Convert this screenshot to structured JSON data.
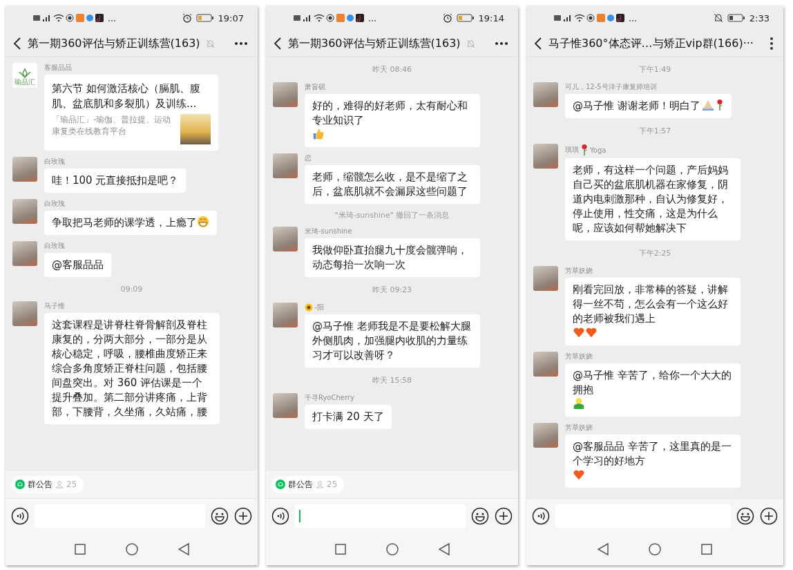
{
  "phones": [
    {
      "status": {
        "time": "19:07",
        "indicator": {
          "kind": "alarm"
        }
      },
      "header": {
        "title": "第一期360评估与矫正训练营(163)",
        "muted": true,
        "menu": {
          "kind": "horizontal"
        }
      },
      "messages": [
        {
          "kind": "link",
          "sender": "客服品品",
          "avatar": {
            "kind": "logo",
            "text": "瑜品汇"
          },
          "title": "第六节  如何激活核心（膈肌、腹肌、盆底肌和多裂肌）及训练...",
          "description": "「瑜品汇」-瑜伽、普拉提、运动康复类在线教育平台"
        },
        {
          "kind": "text",
          "sender": "白玫瑰",
          "avatar": {
            "kind": "photo"
          },
          "text": "哇！100 元直接抵扣是吧？"
        },
        {
          "kind": "text",
          "sender": "白玫瑰",
          "avatar": {
            "kind": "photo"
          },
          "text": "争取把马老师的课学透，上瘾了",
          "emojis": [
            {
              "kind": "grin"
            }
          ]
        },
        {
          "kind": "text",
          "sender": "白玫瑰",
          "avatar": {
            "kind": "photo"
          },
          "text": "@客服品品"
        },
        {
          "kind": "time",
          "text": "09:09"
        },
        {
          "kind": "text",
          "sender": "马子惟",
          "avatar": {
            "kind": "photo"
          },
          "text": "这套课程是讲脊柱脊骨解剖及脊柱康复的，分两大部分，一部分是从核心稳定，呼吸，腰椎曲度矫正来综合多角度矫正脊柱问题，包括腰间盘突出。对 360 评估课是一个提升叠加。第二部分讲疼痛，上背部，下腰背，久坐痛，久站痛，腰"
        }
      ],
      "announcement": {
        "label": "群公告",
        "count": "25"
      },
      "nav_buttons": [
        {
          "kind": "recent"
        },
        {
          "kind": "home"
        },
        {
          "kind": "back"
        }
      ]
    },
    {
      "status": {
        "time": "19:14",
        "indicator": {
          "kind": "alarm"
        }
      },
      "header": {
        "title": "第一期360评估与矫正训练营(163)",
        "muted": true,
        "menu": {
          "kind": "horizontal"
        }
      },
      "messages": [
        {
          "kind": "time",
          "text": "昨天 08:46"
        },
        {
          "kind": "text",
          "sender": "萧旨砚",
          "avatar": {
            "kind": "photo"
          },
          "text": "好的，难得的好老师，太有耐心和专业知识了",
          "emojis": [
            {
              "kind": "thumbs"
            }
          ]
        },
        {
          "kind": "text",
          "sender": "恋",
          "avatar": {
            "kind": "photo"
          },
          "text": "老师，缩髋怎么收，是不是缩了之后，盆底肌就不会漏尿这些问题了"
        },
        {
          "kind": "recall",
          "text": "\"米琦-sunshine\" 撤回了一条消息"
        },
        {
          "kind": "text",
          "sender": "米琦-sunshine",
          "avatar": {
            "kind": "photo"
          },
          "text": "我做仰卧直抬腿九十度会髋弹响，动态每抬一次响一次"
        },
        {
          "kind": "time",
          "text": "昨天 09:23"
        },
        {
          "kind": "text",
          "sender": [
            {
              "kind": "sunflower"
            },
            {
              "kind": "text",
              "text": "-阳"
            }
          ],
          "avatar": {
            "kind": "photo"
          },
          "text": "@马子惟  老师我是不是要松解大腿外侧肌肉，加强腿内收肌的力量练习才可以改善呀？"
        },
        {
          "kind": "time",
          "text": "昨天 15:58"
        },
        {
          "kind": "text",
          "sender": "千寻RyoCherry",
          "avatar": {
            "kind": "photo"
          },
          "text": "打卡满 20 天了"
        }
      ],
      "announcement": {
        "label": "群公告",
        "count": "25"
      },
      "input": {
        "focused": true
      },
      "nav_buttons": [
        {
          "kind": "recent"
        },
        {
          "kind": "home"
        },
        {
          "kind": "back"
        }
      ]
    },
    {
      "status": {
        "time": "2:33",
        "indicator": {
          "kind": "bell-off"
        }
      },
      "header": {
        "title": "马子惟360°体态评…与矫正vip群(166)···",
        "menu": {
          "kind": "vertical"
        }
      },
      "messages": [
        {
          "kind": "time",
          "text": "下午1:49"
        },
        {
          "kind": "text",
          "sender": "可儿，12-5号洋子康复师培训",
          "avatar": {
            "kind": "photo"
          },
          "text": "@马子惟  谢谢老师！明白了",
          "emojis": [
            {
              "kind": "pray"
            },
            {
              "kind": "rose"
            }
          ]
        },
        {
          "kind": "time",
          "text": "下午1:57"
        },
        {
          "kind": "text",
          "sender": [
            {
              "kind": "text",
              "text": "琪琪"
            },
            {
              "kind": "rose"
            },
            {
              "kind": "text",
              "text": "Yoga"
            }
          ],
          "avatar": {
            "kind": "photo"
          },
          "text": "老师，有这样一个问题，产后妈妈自己买的盆底肌机器在家修复，阴道内电刺激那种，自认为修复好，停止使用，性交痛，这是为什么呢，应该如何帮她解决下"
        },
        {
          "kind": "time",
          "text": "下午2:25"
        },
        {
          "kind": "text",
          "sender": "芳草妖娆",
          "avatar": {
            "kind": "photo"
          },
          "text": "刚看完回放，非常棒的答疑，讲解得一丝不苟，怎么会有一个这么好的老师被我们遇上",
          "emojis": [
            {
              "kind": "heart"
            },
            {
              "kind": "heart"
            }
          ]
        },
        {
          "kind": "text",
          "sender": "芳草妖娆",
          "avatar": {
            "kind": "photo"
          },
          "text": "@马子惟  辛苦了，给你一个大大的拥抱",
          "emojis": [
            {
              "kind": "hug"
            }
          ]
        },
        {
          "kind": "text",
          "sender": "芳草妖娆",
          "avatar": {
            "kind": "photo"
          },
          "text": "@客服品品  辛苦了，这里真的是一个学习的好地方",
          "emojis": [
            {
              "kind": "heart"
            }
          ]
        }
      ],
      "nav_buttons": [
        {
          "kind": "back"
        },
        {
          "kind": "home"
        },
        {
          "kind": "recent"
        }
      ]
    }
  ]
}
